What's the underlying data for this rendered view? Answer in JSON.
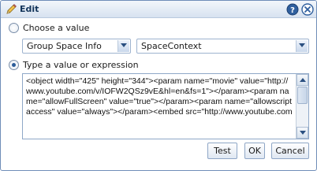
{
  "dialog": {
    "title": "Edit",
    "icons": {
      "title": "pencil-icon",
      "help": "help-icon",
      "close": "close-icon"
    }
  },
  "choose_value": {
    "label": "Choose a value",
    "selected": false,
    "group_select": {
      "value": "Group Space Info"
    },
    "property_select": {
      "value": "SpaceContext"
    }
  },
  "expression": {
    "label": "Type a value or expression",
    "selected": true,
    "text": "<object width=\"425\" height=\"344\"><param name=\"movie\" value=\"http://www.youtube.com/v/IOFW2QSz9vE&hl=en&fs=1\"></param><param name=\"allowFullScreen\" value=\"true\"></param><param name=\"allowscriptaccess\" value=\"always\"></param><embed src=\"http://www.youtube.com"
  },
  "buttons": {
    "test": "Test",
    "ok": "OK",
    "cancel": "Cancel"
  },
  "colors": {
    "accent": "#2b5c99",
    "border": "#6f8db8",
    "title_bg": "#d7e2f0"
  }
}
